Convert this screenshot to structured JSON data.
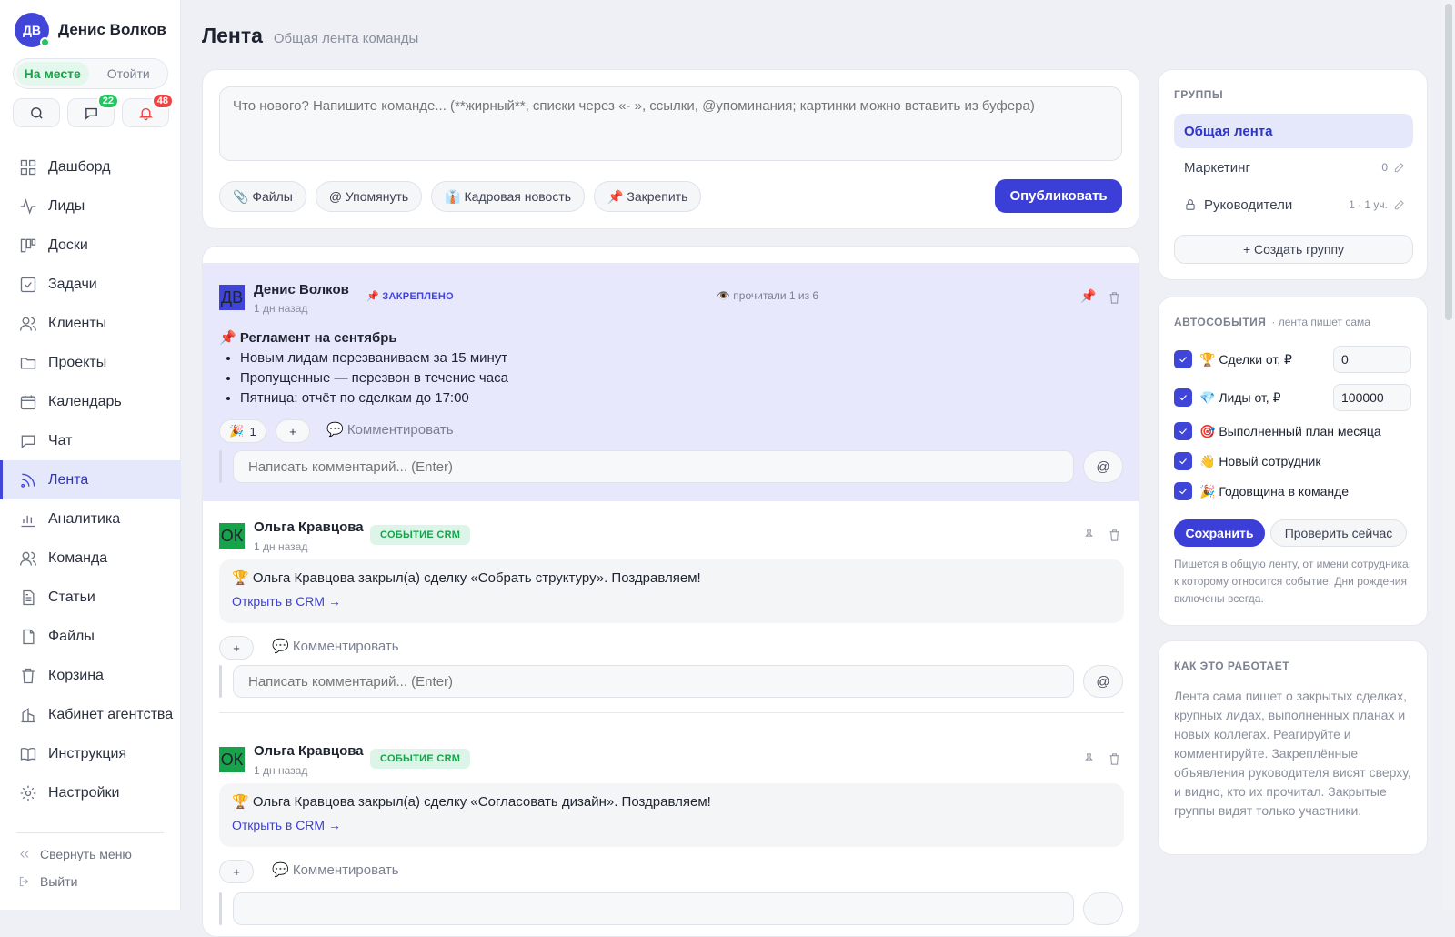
{
  "user": {
    "initials": "ДВ",
    "name": "Денис Волков"
  },
  "status": {
    "present": "На месте",
    "away": "Отойти"
  },
  "badges": {
    "chat": "22",
    "notifications": "48"
  },
  "nav": [
    {
      "label": "Дашборд",
      "icon": "dashboard-icon"
    },
    {
      "label": "Лиды",
      "icon": "activity-icon"
    },
    {
      "label": "Доски",
      "icon": "board-icon"
    },
    {
      "label": "Задачи",
      "icon": "tasks-icon"
    },
    {
      "label": "Клиенты",
      "icon": "clients-icon"
    },
    {
      "label": "Проекты",
      "icon": "folder-icon"
    },
    {
      "label": "Календарь",
      "icon": "calendar-icon"
    },
    {
      "label": "Чат",
      "icon": "chat-icon"
    },
    {
      "label": "Лента",
      "icon": "feed-icon"
    },
    {
      "label": "Аналитика",
      "icon": "analytics-icon"
    },
    {
      "label": "Команда",
      "icon": "team-icon"
    },
    {
      "label": "Статьи",
      "icon": "articles-icon"
    },
    {
      "label": "Файлы",
      "icon": "file-icon"
    },
    {
      "label": "Корзина",
      "icon": "trash-icon"
    },
    {
      "label": "Кабинет агентства",
      "icon": "building-icon"
    },
    {
      "label": "Инструкция",
      "icon": "book-icon"
    },
    {
      "label": "Настройки",
      "icon": "settings-icon"
    }
  ],
  "sidebar_footer": {
    "collapse": "Свернуть меню",
    "logout": "Выйти"
  },
  "header": {
    "title": "Лента",
    "subtitle": "Общая лента команды"
  },
  "composer": {
    "placeholder": "Что нового? Напишите команде... (**жирный**, списки через «- », ссылки, @упоминания; картинки можно вставить из буфера)",
    "files": "📎 Файлы",
    "mention": "@ Упомянуть",
    "hr_news": "👔 Кадровая новость",
    "pin": "📌 Закрепить",
    "publish": "Опубликовать"
  },
  "posts": [
    {
      "avatar": "ДВ",
      "author": "Денис Волков",
      "time": "1 дн назад",
      "tag": "📌 ЗАКРЕПЛЕНО",
      "read": "👁️ прочитали 1 из 6",
      "title": "📌 Регламент на сентябрь",
      "items": [
        "Новым лидам перезваниваем за 15 минут",
        "Пропущенные — перезвон в течение часа",
        "Пятница: отчёт по сделкам до 17:00"
      ],
      "reaction": "🎉",
      "reaction_count": "1",
      "add_reaction": "+",
      "comment": "💬 Комментировать",
      "comment_placeholder": "Написать комментарий... (Enter)",
      "mention": "@"
    },
    {
      "avatar": "ОК",
      "author": "Ольга Кравцова",
      "time": "1 дн назад",
      "tag": "СОБЫТИЕ CRM",
      "text": "🏆 Ольга Кравцова закрыл(а) сделку «Собрать структуру». Поздравляем!",
      "link": "Открыть в CRM →",
      "add_reaction": "+",
      "comment": "💬 Комментировать",
      "comment_placeholder": "Написать комментарий... (Enter)",
      "mention": "@"
    },
    {
      "avatar": "ОК",
      "author": "Ольга Кравцова",
      "time": "1 дн назад",
      "tag": "СОБЫТИЕ CRM",
      "text": "🏆 Ольга Кравцова закрыл(а) сделку «Согласовать дизайн». Поздравляем!",
      "link": "Открыть в CRM →",
      "add_reaction": "+",
      "comment": "💬 Комментировать"
    }
  ],
  "groups": {
    "title": "ГРУППЫ",
    "items": [
      {
        "name": "Общая лента"
      },
      {
        "name": "Маркетинг",
        "meta": "0"
      },
      {
        "name": "Руководители",
        "meta": "1 · 1 уч."
      }
    ],
    "create": "+ Создать группу"
  },
  "auto_events": {
    "title": "АВТОСОБЫТИЯ",
    "subtitle": "· лента пишет сама",
    "items": [
      {
        "label": "🏆 Сделки от, ₽",
        "value": "0",
        "checked": true
      },
      {
        "label": "💎 Лиды от, ₽",
        "value": "100000",
        "checked": true
      },
      {
        "label": "🎯 Выполненный план месяца",
        "checked": true
      },
      {
        "label": "👋 Новый сотрудник",
        "checked": true
      },
      {
        "label": "🎉 Годовщина в команде",
        "checked": true
      }
    ],
    "save": "Сохранить",
    "check_now": "Проверить сейчас",
    "note": "Пишется в общую ленту, от имени сотрудника, к которому относится событие. Дни рождения включены всегда."
  },
  "how_it_works": {
    "title": "КАК ЭТО РАБОТАЕТ",
    "text": "Лента сама пишет о закрытых сделках, крупных лидах, выполненных планах и новых коллегах. Реагируйте и комментируйте. Закреплённые объявления руководителя висят сверху, и видно, кто их прочитал. Закрытые группы видят только участники."
  },
  "colors": {
    "accent": "#3b3fd8",
    "active_bg": "#e5e7fb",
    "online": "#22c55e",
    "crm_green": "#16a34a",
    "badge_red": "#ef4444"
  }
}
